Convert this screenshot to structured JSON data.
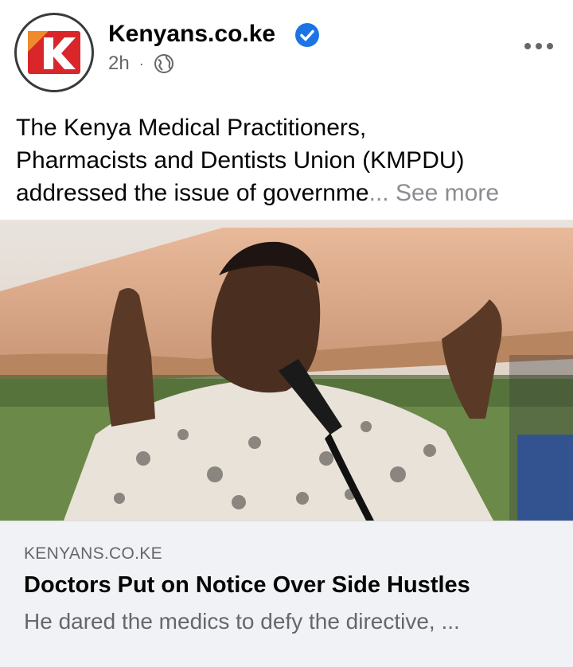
{
  "post": {
    "page_name": "Kenyans.co.ke",
    "time": "2h",
    "separator": "·",
    "privacy_icon": "globe-icon",
    "verified_icon": "verified-badge-icon",
    "more_icon": "more-options-icon",
    "text_line1": "The Kenya Medical Practitioners,",
    "text_line2": "Pharmacists and Dentists Union (KMPDU)",
    "text_line3": "addressed the issue of governme",
    "ellipsis": "...",
    "see_more": "See more"
  },
  "link_preview": {
    "domain": "KENYANS.CO.KE",
    "title": "Doctors Put on Notice Over Side Hustles",
    "description": "He dared the medics to defy the directive, ..."
  },
  "colors": {
    "brand_red": "#d9262a",
    "verified_blue": "#1b74e4",
    "secondary_text": "#65676b",
    "card_bg": "#f0f2f5"
  }
}
